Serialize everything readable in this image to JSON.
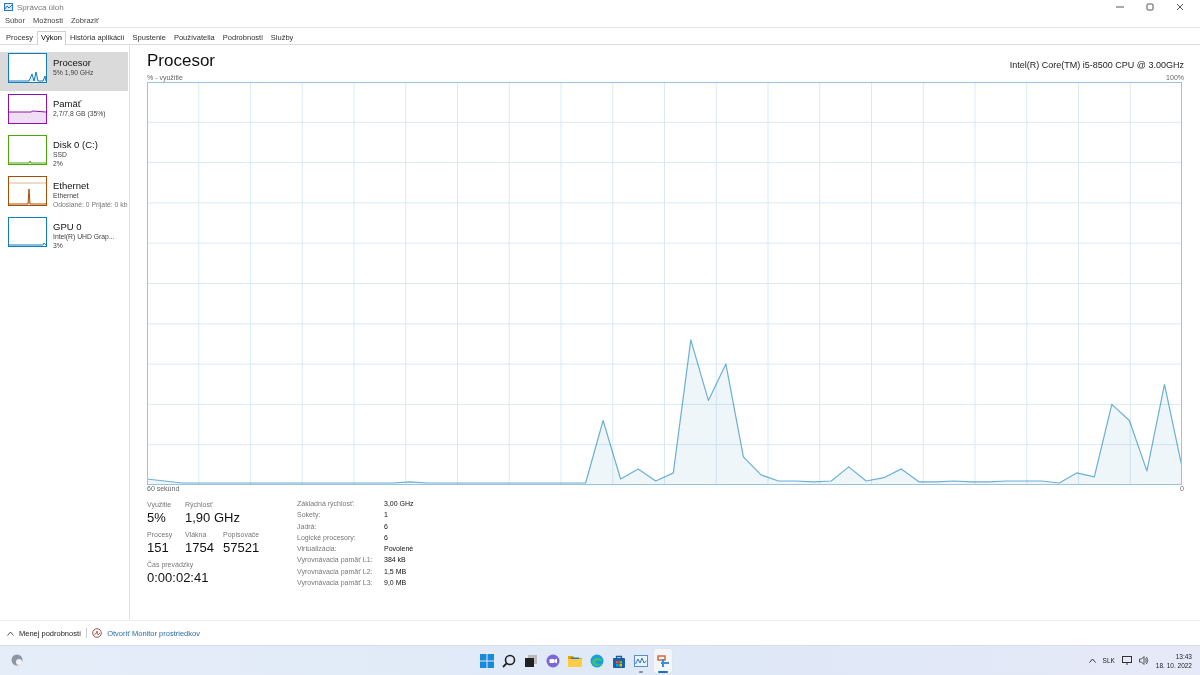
{
  "window": {
    "title": "Správca úloh"
  },
  "menu": [
    "Súbor",
    "Možnosti",
    "Zobraziť"
  ],
  "tabs": [
    {
      "label": "Procesy",
      "selected": false
    },
    {
      "label": "Výkon",
      "selected": true
    },
    {
      "label": "História aplikácií",
      "selected": false
    },
    {
      "label": "Spustenie",
      "selected": false
    },
    {
      "label": "Používatelia",
      "selected": false
    },
    {
      "label": "Podrobnosti",
      "selected": false
    },
    {
      "label": "Služby",
      "selected": false
    }
  ],
  "sidebar": {
    "items": [
      {
        "kind": "cpu",
        "name": "Procesor",
        "lines": [
          "5% 1,90 GHz"
        ],
        "color": "#117dbb",
        "selected": true
      },
      {
        "kind": "memory",
        "name": "Pamäť",
        "lines": [
          "2,7/7,8 GB (35%)"
        ],
        "color": "#8b12ae",
        "selected": false
      },
      {
        "kind": "disk",
        "name": "Disk 0 (C:)",
        "lines": [
          "SSD",
          "2%"
        ],
        "color": "#4da60c",
        "selected": false
      },
      {
        "kind": "ethernet",
        "name": "Ethernet",
        "lines": [
          "Ethernet",
          "Odoslané: 0 Prijaté: 0 kb"
        ],
        "color": "#a74f01",
        "selected": false
      },
      {
        "kind": "gpu",
        "name": "GPU 0",
        "lines": [
          "Intel(R) UHD Grap...",
          "3%"
        ],
        "color": "#117dbb",
        "selected": false
      }
    ]
  },
  "panel": {
    "title": "Procesor",
    "subtitle": "Intel(R) Core(TM) i5-8500 CPU @ 3.00GHz",
    "graph": {
      "y_caption": "% - využitie",
      "y_max": "100%",
      "x_span": "60 sekúnd",
      "x_end": "0"
    },
    "stats": [
      [
        {
          "label": "Využitie",
          "value": "5%"
        },
        {
          "label": "Rýchlosť",
          "value": "1,90 GHz"
        }
      ],
      [
        {
          "label": "Procesy",
          "value": "151"
        },
        {
          "label": "Vlákna",
          "value": "1754"
        },
        {
          "label": "Popisovače",
          "value": "57521"
        }
      ],
      [
        {
          "label": "Čas prevádzky",
          "value": "0:00:02:41"
        }
      ]
    ],
    "details": [
      {
        "label": "Základná rýchlosť:",
        "value": "3,00 GHz"
      },
      {
        "label": "Sokety:",
        "value": "1"
      },
      {
        "label": "Jadrá:",
        "value": "6"
      },
      {
        "label": "Logické procesory:",
        "value": "6"
      },
      {
        "label": "Virtualizácia:",
        "value": "Povolené"
      },
      {
        "label": "Vyrovnávacia pamäť L1:",
        "value": "384 kB"
      },
      {
        "label": "Vyrovnávacia pamäť L2:",
        "value": "1,5 MB"
      },
      {
        "label": "Vyrovnávacia pamäť L3:",
        "value": "9,0 MB"
      }
    ]
  },
  "footer": {
    "less_details": "Menej podrobností",
    "monitor_link": "Otvoriť Monitor prostriedkov"
  },
  "taskbar": {
    "apps": [
      {
        "kind": "start",
        "open": false,
        "selected": false
      },
      {
        "kind": "search",
        "open": false,
        "selected": false
      },
      {
        "kind": "taskview",
        "open": false,
        "selected": false
      },
      {
        "kind": "chat",
        "open": false,
        "selected": false
      },
      {
        "kind": "explorer",
        "open": false,
        "selected": false
      },
      {
        "kind": "edge",
        "open": false,
        "selected": false
      },
      {
        "kind": "store",
        "open": false,
        "selected": false
      },
      {
        "kind": "taskmanager",
        "open": true,
        "selected": false
      },
      {
        "kind": "snipping",
        "open": true,
        "selected": true
      }
    ],
    "language": "SLK",
    "time": "13:43",
    "date": "18. 10. 2022"
  }
}
